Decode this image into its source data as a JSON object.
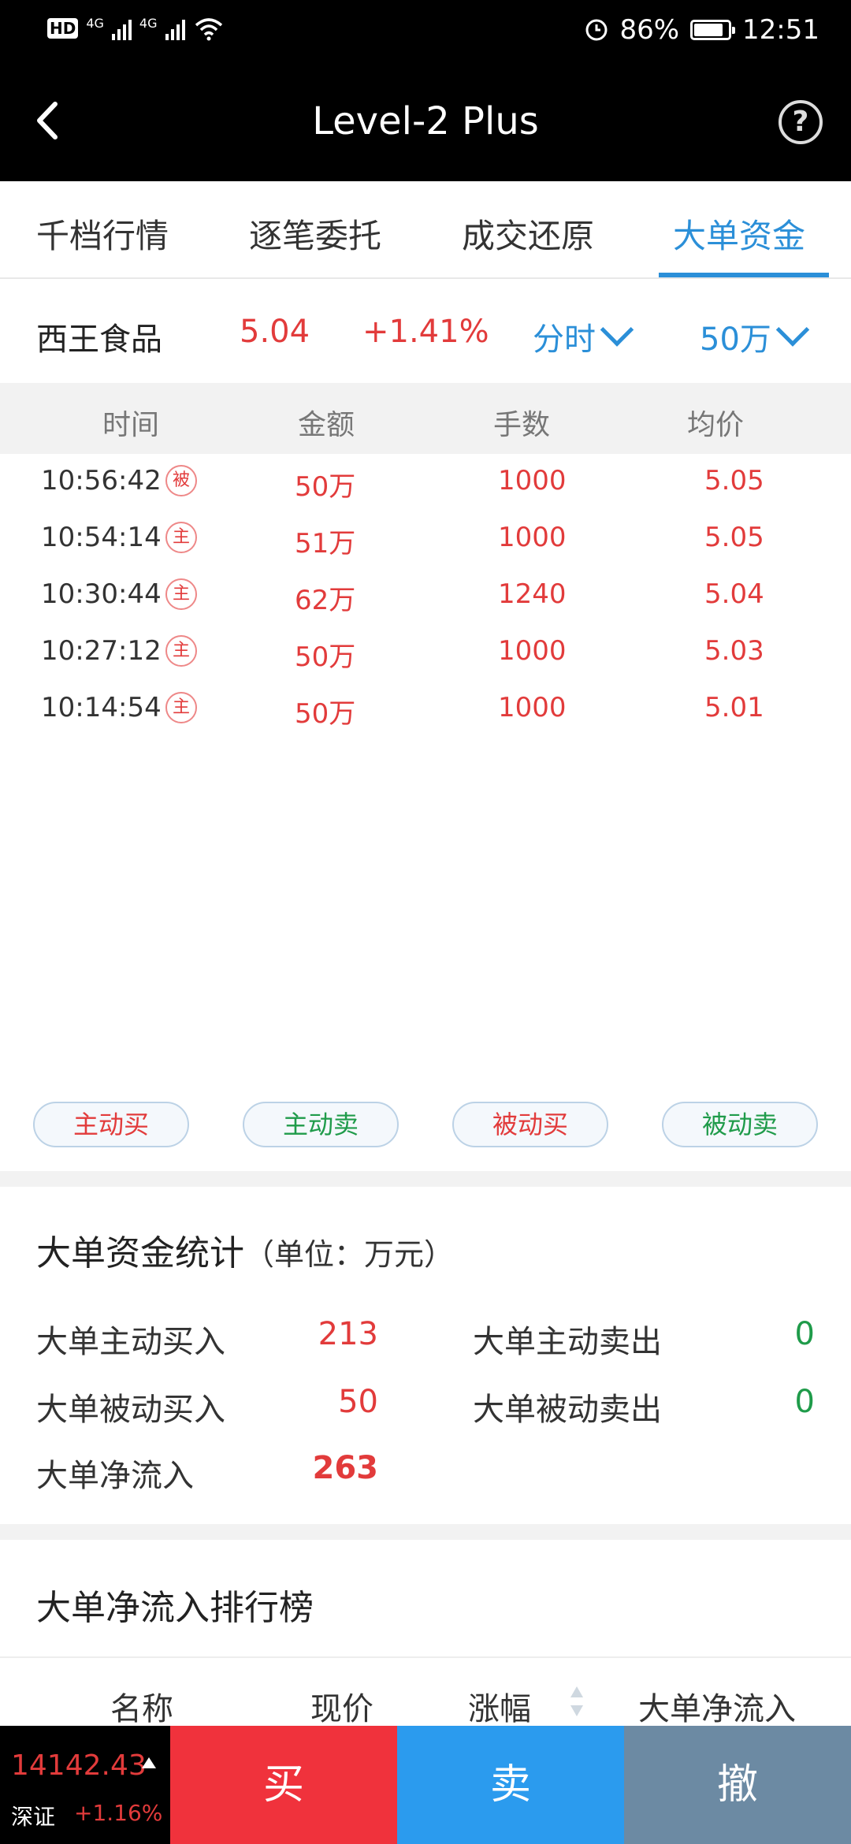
{
  "status_bar": {
    "hd": "HD",
    "sim1": "4G",
    "sim2": "4G",
    "battery": "86%",
    "battery_level": 0.86,
    "time": "12:51"
  },
  "app_bar": {
    "title": "Level-2 Plus",
    "help": "?"
  },
  "tabs": [
    "千档行情",
    "逐笔委托",
    "成交还原",
    "大单资金"
  ],
  "active_tab": 3,
  "quote": {
    "name": "西王食品",
    "price": "5.04",
    "change": "+1.41%",
    "period": "分时",
    "threshold": "50万"
  },
  "table": {
    "headers": [
      "时间",
      "金额",
      "手数",
      "均价"
    ],
    "rows": [
      {
        "time": "10:56:42",
        "tag": "被",
        "amount": "50万",
        "volume": "1000",
        "avg": "5.05"
      },
      {
        "time": "10:54:14",
        "tag": "主",
        "amount": "51万",
        "volume": "1000",
        "avg": "5.05"
      },
      {
        "time": "10:30:44",
        "tag": "主",
        "amount": "62万",
        "volume": "1240",
        "avg": "5.04"
      },
      {
        "time": "10:27:12",
        "tag": "主",
        "amount": "50万",
        "volume": "1000",
        "avg": "5.03"
      },
      {
        "time": "10:14:54",
        "tag": "主",
        "amount": "50万",
        "volume": "1000",
        "avg": "5.01"
      }
    ]
  },
  "legend": [
    "主动买",
    "主动卖",
    "被动买",
    "被动卖"
  ],
  "stats": {
    "title": "大单资金统计",
    "unit": "（单位：万元）",
    "active_buy_label": "大单主动买入",
    "active_buy": "213",
    "active_sell_label": "大单主动卖出",
    "active_sell": "0",
    "passive_buy_label": "大单被动买入",
    "passive_buy": "50",
    "passive_sell_label": "大单被动卖出",
    "passive_sell": "0",
    "net_label": "大单净流入",
    "net": "263"
  },
  "ranking": {
    "title": "大单净流入排行榜",
    "headers": [
      "名称",
      "现价",
      "涨幅",
      "大单净流入"
    ]
  },
  "bottom": {
    "index_value": "14142.43",
    "index_name": "深证",
    "index_change": "+1.16%",
    "buy": "买",
    "sell": "卖",
    "cancel": "撤"
  },
  "colors": {
    "accent": "#2b8fd8",
    "up": "#e23b3b",
    "down": "#1f9b4a",
    "buy_bg": "#f0323c",
    "sell_bg": "#2b9bee",
    "cancel_bg": "#6c8aa3"
  }
}
